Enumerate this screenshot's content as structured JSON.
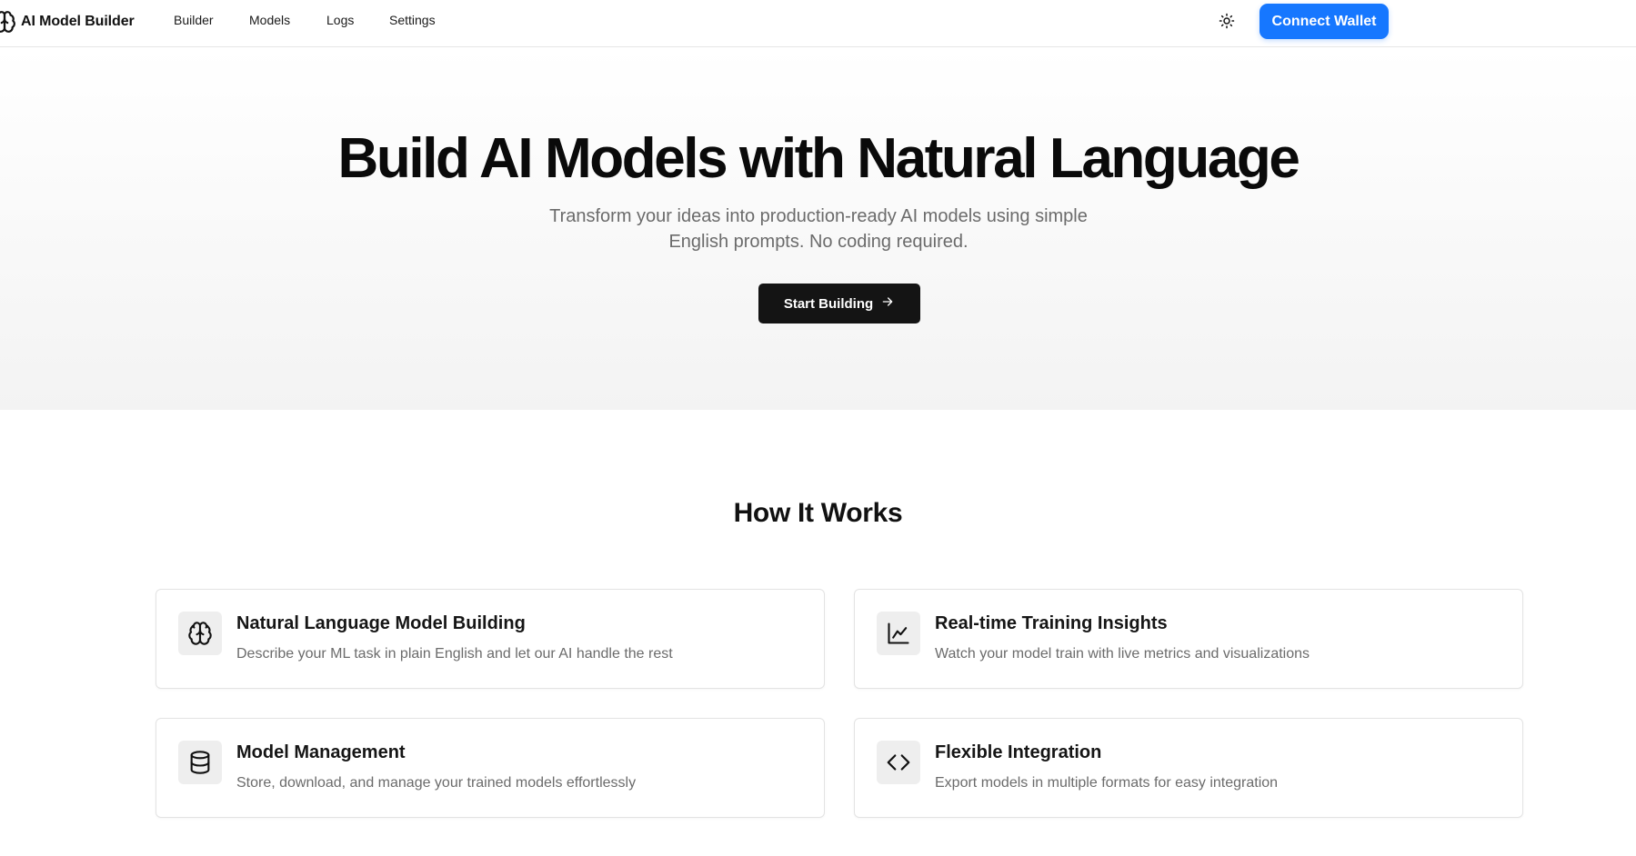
{
  "header": {
    "app_name": "AI Model Builder",
    "nav": [
      {
        "label": "Builder"
      },
      {
        "label": "Models"
      },
      {
        "label": "Logs"
      },
      {
        "label": "Settings"
      }
    ],
    "theme_icon": "sun-icon",
    "connect_wallet_label": "Connect Wallet"
  },
  "hero": {
    "title": "Build AI Models with Natural Language",
    "subtitle": "Transform your ideas into production-ready AI models using simple English prompts. No coding required.",
    "cta_label": "Start Building",
    "cta_icon": "arrow-right-icon"
  },
  "how_it_works": {
    "title": "How It Works",
    "features": [
      {
        "icon": "brain-icon",
        "title": "Natural Language Model Building",
        "description": "Describe your ML task in plain English and let our AI handle the rest"
      },
      {
        "icon": "line-chart-icon",
        "title": "Real-time Training Insights",
        "description": "Watch your model train with live metrics and visualizations"
      },
      {
        "icon": "database-icon",
        "title": "Model Management",
        "description": "Store, download, and manage your trained models effortlessly"
      },
      {
        "icon": "code-icon",
        "title": "Flexible Integration",
        "description": "Export models in multiple formats for easy integration"
      }
    ]
  },
  "colors": {
    "accent": "#1677ff",
    "primary_button": "#141414",
    "muted_text": "#6b6b6b"
  }
}
